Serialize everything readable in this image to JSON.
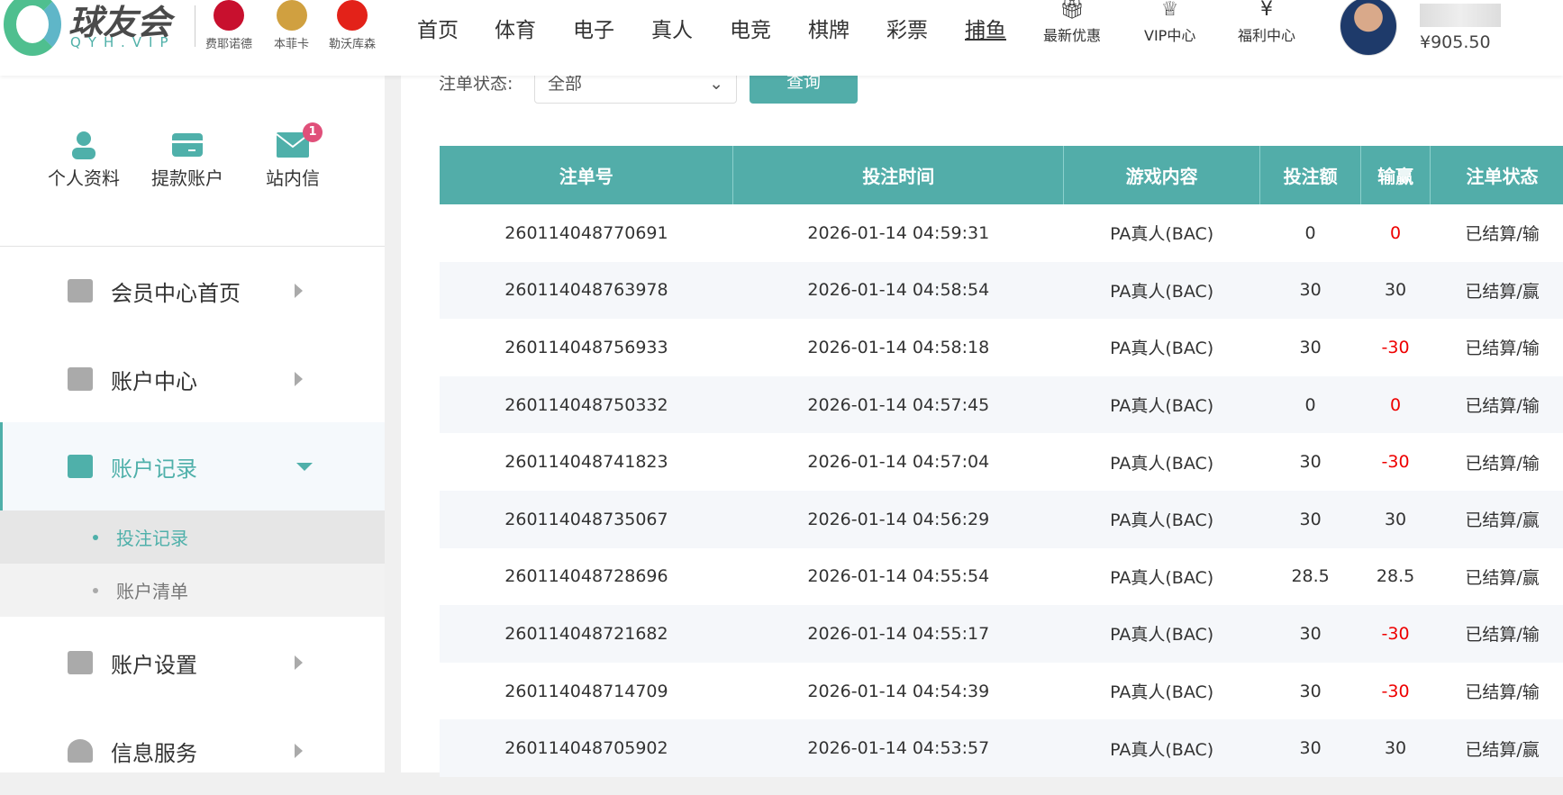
{
  "header": {
    "logo_cn": "球友会",
    "logo_en": "QYH.VIP",
    "clubs": [
      {
        "name": "费耶诺德",
        "color": "#c8102e"
      },
      {
        "name": "本菲卡",
        "color": "#d0a040"
      },
      {
        "name": "勒沃库森",
        "color": "#e32219"
      }
    ],
    "nav": [
      "首页",
      "体育",
      "电子",
      "真人",
      "电竞",
      "棋牌",
      "彩票",
      "捕鱼"
    ],
    "nav_icons": [
      {
        "label": "最新优惠",
        "icon": "gift-icon"
      },
      {
        "label": "VIP中心",
        "icon": "crown-icon"
      },
      {
        "label": "福利中心",
        "icon": "red-envelope-icon"
      }
    ],
    "balance": "¥905.50"
  },
  "sidebar": {
    "quick": [
      {
        "label": "个人资料",
        "icon": "user-icon"
      },
      {
        "label": "提款账户",
        "icon": "card-icon"
      },
      {
        "label": "站内信",
        "icon": "mail-icon",
        "badge": "1"
      }
    ],
    "menu": [
      {
        "label": "会员中心首页"
      },
      {
        "label": "账户中心"
      },
      {
        "label": "账户记录",
        "active": true
      },
      {
        "label": "账户设置"
      },
      {
        "label": "信息服务"
      }
    ],
    "sub": [
      {
        "label": "投注记录",
        "active": true
      },
      {
        "label": "账户清单"
      }
    ]
  },
  "filter": {
    "label": "注单状态:",
    "value": "全部",
    "button": "查询"
  },
  "colors": {
    "accent": "#52ada9",
    "negative": "#e00000",
    "badge": "#e0507a"
  },
  "table": {
    "columns": [
      "注单号",
      "投注时间",
      "游戏内容",
      "投注额",
      "输赢",
      "注单状态"
    ],
    "rows": [
      [
        "260114048770691",
        "2026-01-14 04:59:31",
        "PA真人(BAC)",
        "0",
        "0",
        "已结算/输"
      ],
      [
        "260114048763978",
        "2026-01-14 04:58:54",
        "PA真人(BAC)",
        "30",
        "30",
        "已结算/赢"
      ],
      [
        "260114048756933",
        "2026-01-14 04:58:18",
        "PA真人(BAC)",
        "30",
        "-30",
        "已结算/输"
      ],
      [
        "260114048750332",
        "2026-01-14 04:57:45",
        "PA真人(BAC)",
        "0",
        "0",
        "已结算/输"
      ],
      [
        "260114048741823",
        "2026-01-14 04:57:04",
        "PA真人(BAC)",
        "30",
        "-30",
        "已结算/输"
      ],
      [
        "260114048735067",
        "2026-01-14 04:56:29",
        "PA真人(BAC)",
        "30",
        "30",
        "已结算/赢"
      ],
      [
        "260114048728696",
        "2026-01-14 04:55:54",
        "PA真人(BAC)",
        "28.5",
        "28.5",
        "已结算/赢"
      ],
      [
        "260114048721682",
        "2026-01-14 04:55:17",
        "PA真人(BAC)",
        "30",
        "-30",
        "已结算/输"
      ],
      [
        "260114048714709",
        "2026-01-14 04:54:39",
        "PA真人(BAC)",
        "30",
        "-30",
        "已结算/输"
      ],
      [
        "260114048705902",
        "2026-01-14 04:53:57",
        "PA真人(BAC)",
        "30",
        "30",
        "已结算/赢"
      ]
    ]
  }
}
